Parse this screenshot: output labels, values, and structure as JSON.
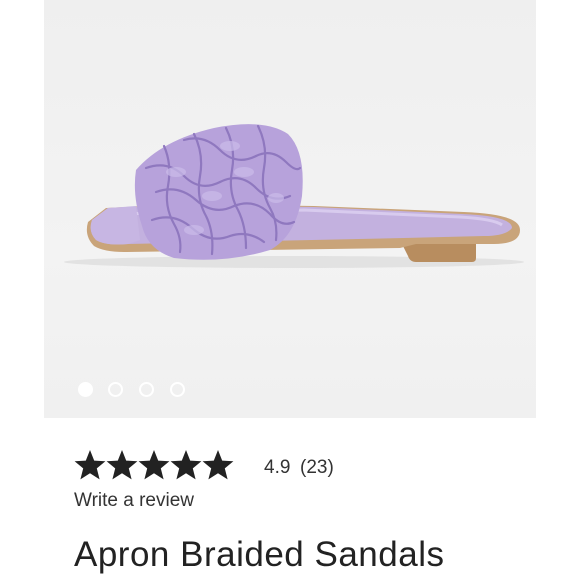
{
  "gallery": {
    "image": "lavender braided slide sandal",
    "image_count": 4,
    "active_index": 0
  },
  "rating": {
    "value": "4.9",
    "count": "(23)",
    "stars_filled": 5,
    "stars_total": 5,
    "star_color": "#222222"
  },
  "review": {
    "link_label": "Write a review"
  },
  "product": {
    "title": "Apron Braided Sandals"
  },
  "colors": {
    "gallery_bg": "#efefef",
    "sandal_lavender": "#b9a6d9",
    "sole_tan": "#c9a47a",
    "text": "#333333"
  }
}
